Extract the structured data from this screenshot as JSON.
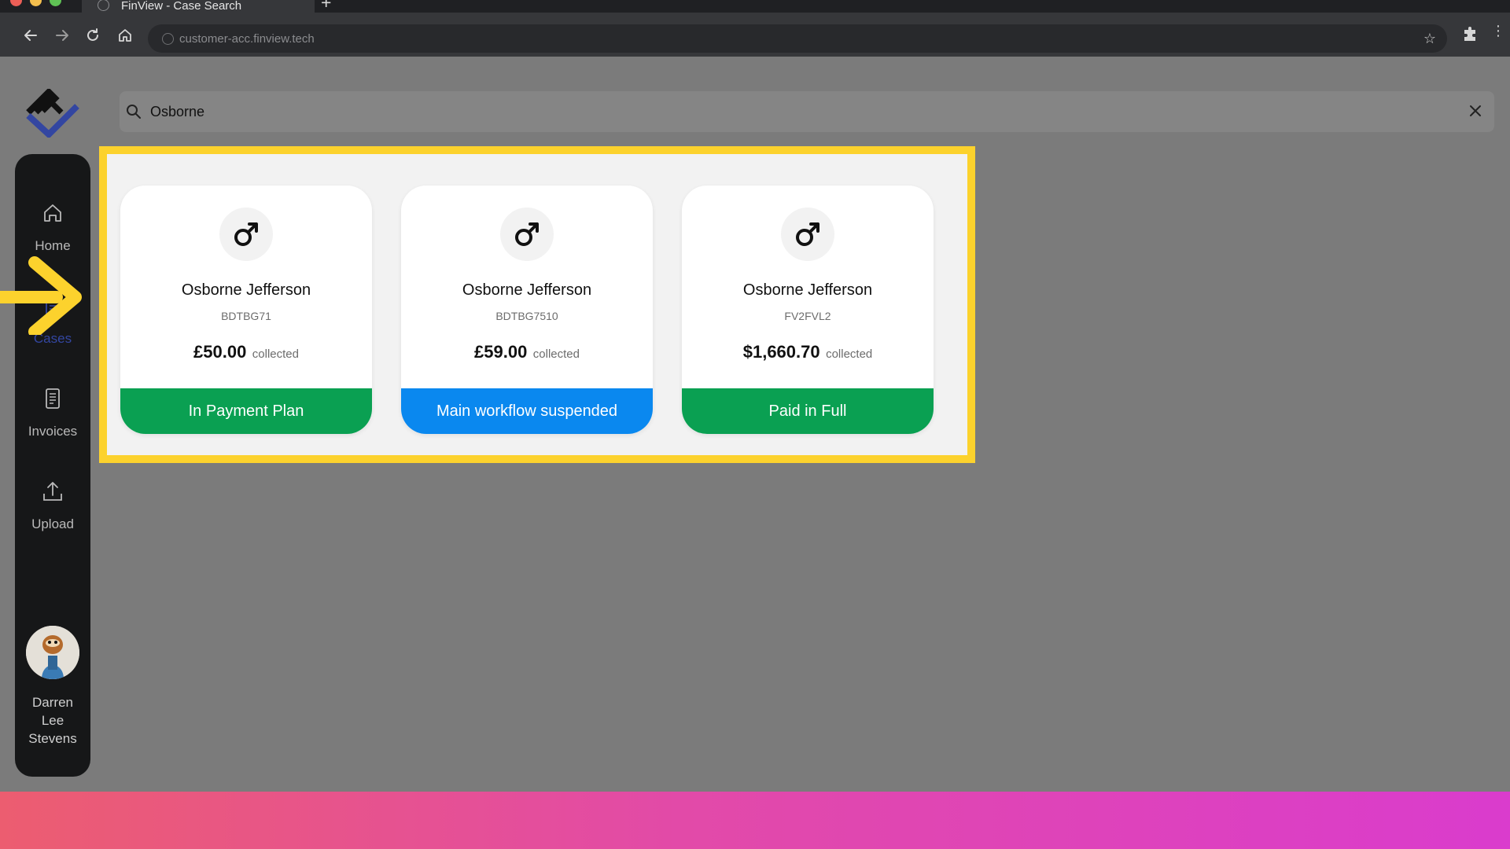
{
  "browser": {
    "tab_title": "FinView - Case Search",
    "url": "customer-acc.finview.tech"
  },
  "search": {
    "query": "Osborne"
  },
  "sidebar": {
    "items": [
      {
        "label": "Home",
        "icon": "home-icon"
      },
      {
        "label": "Cases",
        "icon": "cases-icon",
        "active": true
      },
      {
        "label": "Invoices",
        "icon": "invoice-icon"
      },
      {
        "label": "Upload",
        "icon": "upload-icon"
      }
    ],
    "user": {
      "name_line1": "Darren",
      "name_line2": "Lee",
      "name_line3": "Stevens"
    }
  },
  "cards": [
    {
      "name": "Osborne Jefferson",
      "ref": "BDTBG71",
      "amount": "£50.00",
      "collected_label": "collected",
      "status": "In Payment Plan",
      "status_color": "#0aa052"
    },
    {
      "name": "Osborne Jefferson",
      "ref": "BDTBG7510",
      "amount": "£59.00",
      "collected_label": "collected",
      "status": "Main workflow suspended",
      "status_color": "#0a88ef"
    },
    {
      "name": "Osborne Jefferson",
      "ref": "FV2FVL2",
      "amount": "$1,660.70",
      "collected_label": "collected",
      "status": "Paid in Full",
      "status_color": "#0aa052"
    }
  ],
  "colors": {
    "highlight": "#fcd22d",
    "brand_blue": "#3346a1"
  }
}
